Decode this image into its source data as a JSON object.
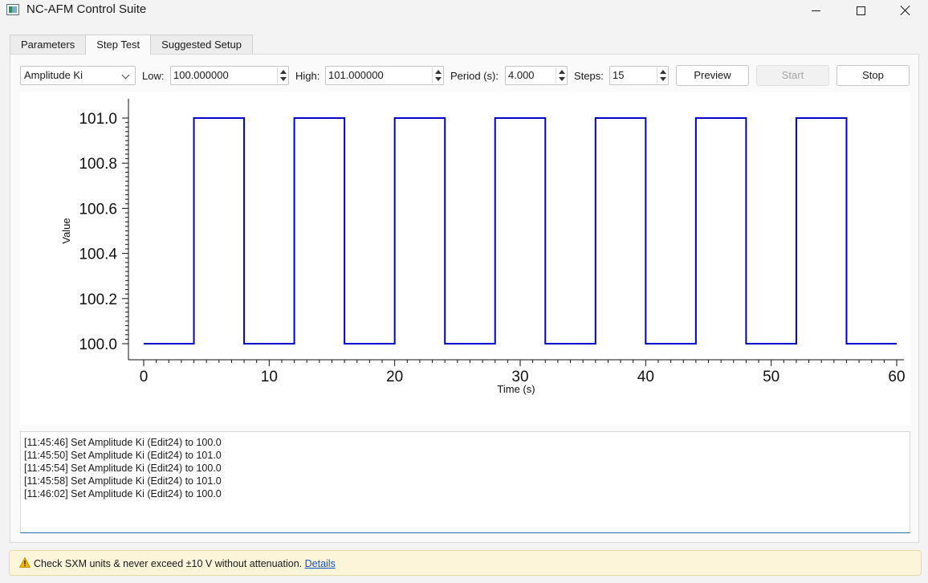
{
  "window": {
    "title": "NC-AFM Control Suite"
  },
  "tabs": [
    {
      "label": "Parameters"
    },
    {
      "label": "Step Test",
      "active": true
    },
    {
      "label": "Suggested Setup"
    }
  ],
  "controls": {
    "parameter_select": "Amplitude Ki",
    "low_label": "Low:",
    "low_value": "100.000000",
    "high_label": "High:",
    "high_value": "101.000000",
    "period_label": "Period (s):",
    "period_value": "4.000",
    "steps_label": "Steps:",
    "steps_value": "15",
    "preview_label": "Preview",
    "start_label": "Start",
    "stop_label": "Stop"
  },
  "chart_data": {
    "type": "line",
    "title": "",
    "xlabel": "Time (s)",
    "ylabel": "Value",
    "xlim": [
      0,
      60
    ],
    "ylim": [
      100.0,
      101.0
    ],
    "x_ticks": [
      "0",
      "10",
      "20",
      "30",
      "40",
      "50",
      "60"
    ],
    "y_ticks": [
      "100.0",
      "100.2",
      "100.4",
      "100.6",
      "100.8",
      "101.0"
    ],
    "series": [
      {
        "color": "#0000cc",
        "step": true,
        "x": [
          0,
          4,
          8,
          12,
          16,
          20,
          24,
          28,
          32,
          36,
          40,
          44,
          48,
          52,
          56,
          60
        ],
        "y": [
          100.0,
          101.0,
          100.0,
          101.0,
          100.0,
          101.0,
          100.0,
          101.0,
          100.0,
          101.0,
          100.0,
          101.0,
          100.0,
          101.0,
          100.0,
          100.0
        ]
      }
    ]
  },
  "log": [
    "[11:45:46] Set Amplitude Ki (Edit24) to 100.0",
    "[11:45:50] Set Amplitude Ki (Edit24) to 101.0",
    "[11:45:54] Set Amplitude Ki (Edit24) to 100.0",
    "[11:45:58] Set Amplitude Ki (Edit24) to 101.0",
    "[11:46:02] Set Amplitude Ki (Edit24) to 100.0"
  ],
  "warning": {
    "icon": "warning-icon",
    "text": "Check SXM units & never exceed ±10 V without attenuation.",
    "link": "Details"
  }
}
